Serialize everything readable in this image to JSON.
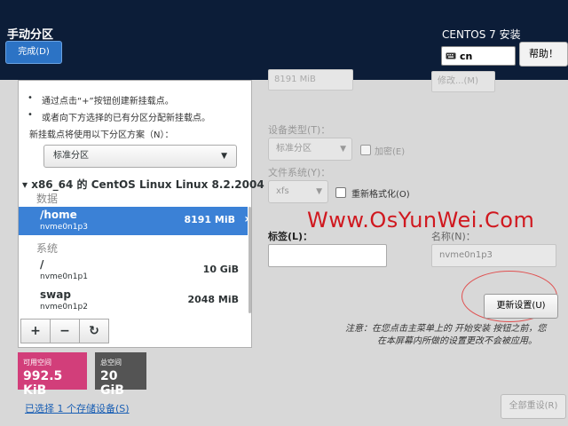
{
  "header": {
    "title": "手动分区",
    "done_label": "完成(D)",
    "product": "CENTOS 7 安装",
    "keyboard_layout": "cn",
    "help_label": "帮助！"
  },
  "left": {
    "hint1": "通过点击“+”按钮创建新挂载点。",
    "hint2": "或者向下方选择的已有分区分配新挂载点。",
    "scheme_prompt": "新挂载点将使用以下分区方案（N）：",
    "scheme_value": "标准分区",
    "os_heading": "x86_64 的 CentOS Linux Linux 8.2.2004",
    "data_group": "数据",
    "system_group": "系统",
    "mounts": [
      {
        "mount": "/home",
        "device": "nvme0n1p3",
        "size": "8191 MiB"
      },
      {
        "mount": "/",
        "device": "nvme0n1p1",
        "size": "10 GiB"
      },
      {
        "mount": "swap",
        "device": "nvme0n1p2",
        "size": "2048 MiB"
      }
    ]
  },
  "tools": {
    "add": "+",
    "remove": "−",
    "refresh": "↻"
  },
  "space": {
    "available_label": "可用空间",
    "available_value": "992.5 KiB",
    "total_label": "总空间",
    "total_value": "20 GiB",
    "available_color": "#d23e7a",
    "total_color": "#545454"
  },
  "storage_link": "已选择 1 个存储设备(S)",
  "reset_label": "全部重设(R)",
  "right": {
    "capacity_value": "8191 MiB",
    "modify_label": "修改...(M)",
    "device_type_label": "设备类型(T)：",
    "device_type_value": "标准分区",
    "encrypt_label": "加密(E)",
    "fs_label": "文件系统(Y)：",
    "fs_value": "xfs",
    "reformat_label": "重新格式化(O)",
    "tag_label": "标签(L)：",
    "name_label": "名称(N)：",
    "name_value": "nvme0n1p3",
    "update_label": "更新设置(U)",
    "note_line1": "注意：在您点击主菜单上的 开始安装 按钮之前，您",
    "note_line2": "在本屏幕内所做的设置更改不会被应用。"
  },
  "watermark": "Www.OsYunWei.Com"
}
